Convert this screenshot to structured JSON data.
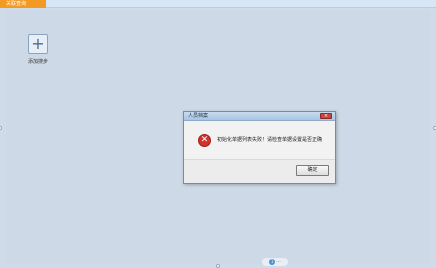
{
  "top_bar": {
    "active_tab_label": "关联查询"
  },
  "main": {
    "add_step": {
      "icon": "plus-icon",
      "label": "添加搜步"
    }
  },
  "dialog": {
    "title": "人员档案",
    "close_icon": "close-icon",
    "error_icon": "error-icon",
    "message": "初始化单据列表失败！请检查单据设置是否正确",
    "ok_button_label": "确定"
  },
  "watermark": {
    "badge": "1",
    "text": "···"
  },
  "colors": {
    "tab_orange": "#f39a24",
    "background": "#cfdbe8",
    "error_red": "#d3322b",
    "dialog_title_blue": "#a9c5e4"
  }
}
